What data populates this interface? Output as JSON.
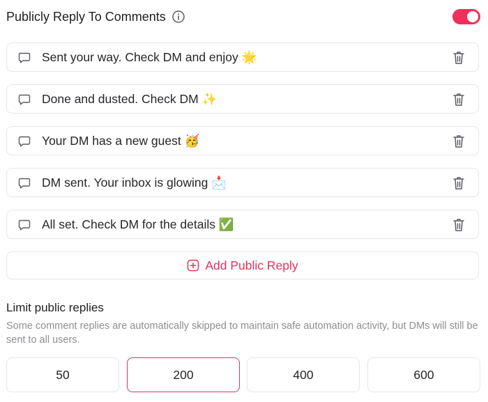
{
  "header": {
    "title": "Publicly Reply To Comments",
    "toggle_on": true,
    "accent": "#f0305a"
  },
  "replies": [
    {
      "text": "Sent your way. Check DM and enjoy 🌟"
    },
    {
      "text": "Done and dusted. Check DM ✨"
    },
    {
      "text": "Your DM has a new guest 🥳"
    },
    {
      "text": "DM sent. Your inbox is glowing 📩"
    },
    {
      "text": "All set. Check DM for the details ✅"
    }
  ],
  "add_button": {
    "label": "Add Public Reply"
  },
  "limit": {
    "title": "Limit public replies",
    "description": "Some comment replies are automatically skipped to maintain safe automation activity, but DMs will still be sent to all users.",
    "options": [
      "50",
      "200",
      "400",
      "600"
    ],
    "selected": "200"
  }
}
